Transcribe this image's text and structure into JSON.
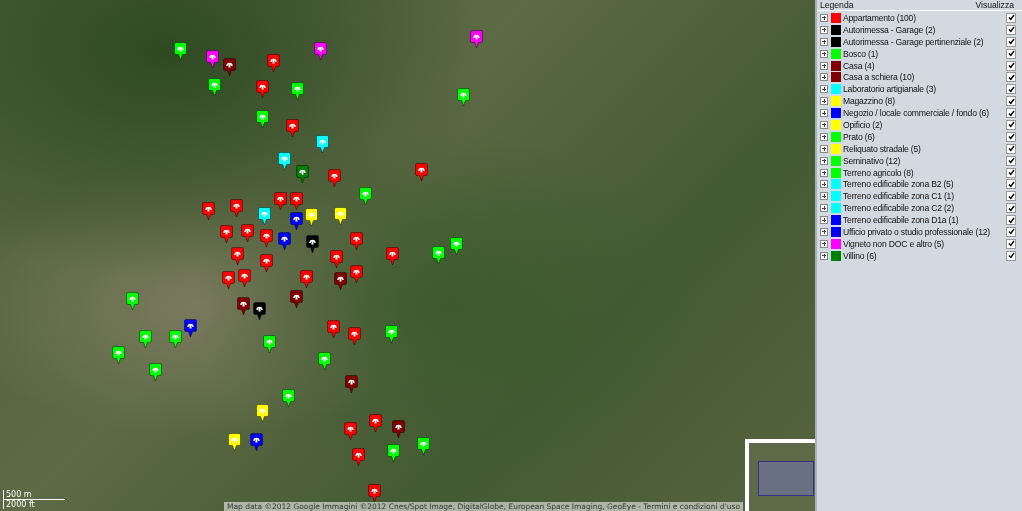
{
  "map": {
    "attribution": "Map data ©2012 Google Immagini ©2012 Cnes/Spot Image, DigitalGlobe, European Space Imaging, GeoEye - Termini e condizioni d'uso",
    "scale": [
      "500 m",
      "2000 ft"
    ]
  },
  "legend": {
    "title": "Legenda",
    "visibility_header": "Visualizza",
    "items": [
      {
        "label": "Appartamento (100)",
        "color": "#ff0000",
        "checked": true
      },
      {
        "label": "Autorimessa - Garage (2)",
        "color": "#000000",
        "checked": true
      },
      {
        "label": "Autorimessa - Garage pertinenziale (2)",
        "color": "#000000",
        "checked": true
      },
      {
        "label": "Bosco (1)",
        "color": "#00ff00",
        "checked": true
      },
      {
        "label": "Casa (4)",
        "color": "#800000",
        "checked": true
      },
      {
        "label": "Casa a schiera (10)",
        "color": "#800000",
        "checked": true
      },
      {
        "label": "Laboratorio artigianale (3)",
        "color": "#00ffff",
        "checked": true
      },
      {
        "label": "Magazzino (8)",
        "color": "#ffff00",
        "checked": true
      },
      {
        "label": "Negozio / locale commerciale / fondo (6)",
        "color": "#0000ff",
        "checked": true
      },
      {
        "label": "Opificio (2)",
        "color": "#ffff00",
        "checked": true
      },
      {
        "label": "Prato (6)",
        "color": "#00ff00",
        "checked": true
      },
      {
        "label": "Reliquato stradale (5)",
        "color": "#ffff00",
        "checked": true
      },
      {
        "label": "Seminativo (12)",
        "color": "#00ff00",
        "checked": true
      },
      {
        "label": "Terreno agricolo (8)",
        "color": "#00ff00",
        "checked": true
      },
      {
        "label": "Terreno edificabile zona B2 (5)",
        "color": "#00ffff",
        "checked": true
      },
      {
        "label": "Terreno edificabile zona C1 (1)",
        "color": "#00ffff",
        "checked": true
      },
      {
        "label": "Terreno edificabile zona C2 (2)",
        "color": "#00ffff",
        "checked": true
      },
      {
        "label": "Terreno edificabile zona D1a (1)",
        "color": "#0000ff",
        "checked": true
      },
      {
        "label": "Ufficio privato o studio professionale (12)",
        "color": "#0000ff",
        "checked": true
      },
      {
        "label": "Vigneto non DOC e altro (5)",
        "color": "#ff00ff",
        "checked": true
      },
      {
        "label": "Villino (6)",
        "color": "#008000",
        "checked": true
      }
    ]
  }
}
